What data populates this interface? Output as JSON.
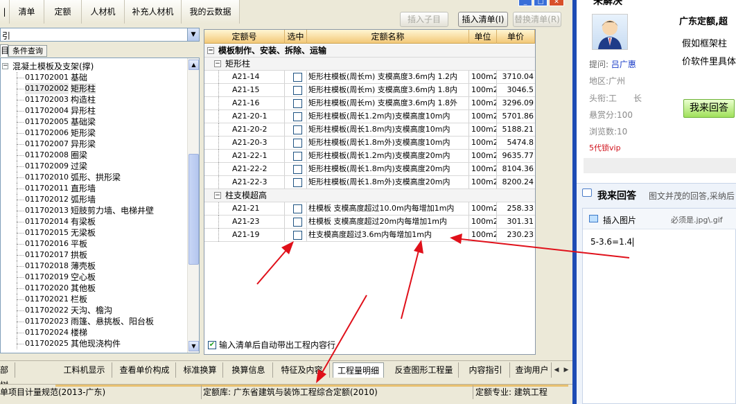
{
  "top_tabs": [
    "清单",
    "定额",
    "人材机",
    "补充人材机",
    "我的云数据"
  ],
  "top_tab_left": "|",
  "window_buttons": [
    "_",
    "□",
    "✕"
  ],
  "actions": {
    "insert_child": "插入子目",
    "insert_list": "插入清单(I)",
    "replace_list": "替换清单(R)"
  },
  "search": {
    "left_value": "引"
  },
  "left_tabs": {
    "tab1": "目",
    "tab2": "条件查询"
  },
  "tree": {
    "root": "混凝土模板及支架(撑)",
    "items": [
      {
        "code": "011702001",
        "name": "基础"
      },
      {
        "code": "011702002",
        "name": "矩形柱"
      },
      {
        "code": "011702003",
        "name": "构造柱"
      },
      {
        "code": "011702004",
        "name": "异形柱"
      },
      {
        "code": "011702005",
        "name": "基础梁"
      },
      {
        "code": "011702006",
        "name": "矩形梁"
      },
      {
        "code": "011702007",
        "name": "异形梁"
      },
      {
        "code": "011702008",
        "name": "圈梁"
      },
      {
        "code": "011702009",
        "name": "过梁"
      },
      {
        "code": "011702010",
        "name": "弧形、拱形梁"
      },
      {
        "code": "011702011",
        "name": "直形墙"
      },
      {
        "code": "011702012",
        "name": "弧形墙"
      },
      {
        "code": "011702013",
        "name": "短肢剪力墙、电梯井壁"
      },
      {
        "code": "011702014",
        "name": "有梁板"
      },
      {
        "code": "011702015",
        "name": "无梁板"
      },
      {
        "code": "011702016",
        "name": "平板"
      },
      {
        "code": "011702017",
        "name": "拱板"
      },
      {
        "code": "011702018",
        "name": "薄壳板"
      },
      {
        "code": "011702019",
        "name": "空心板"
      },
      {
        "code": "011702020",
        "name": "其他板"
      },
      {
        "code": "011702021",
        "name": "栏板"
      },
      {
        "code": "011702022",
        "name": "天沟、檐沟"
      },
      {
        "code": "011702023",
        "name": "雨篷、悬挑板、阳台板"
      },
      {
        "code": "011702024",
        "name": "楼梯"
      },
      {
        "code": "011702025",
        "name": "其他现浇构件"
      }
    ]
  },
  "grid": {
    "headers": [
      "定额号",
      "选中",
      "定额名称",
      "单位",
      "单价"
    ],
    "group": "模板制作、安装、拆除、运输",
    "sub1": "矩形柱",
    "rows1": [
      {
        "code": "A21-14",
        "name": "矩形柱模板(周长m) 支模高度3.6m内 1.2内",
        "unit": "100m2",
        "price": "3710.04"
      },
      {
        "code": "A21-15",
        "name": "矩形柱模板(周长m) 支模高度3.6m内 1.8内",
        "unit": "100m2",
        "price": "3046.5"
      },
      {
        "code": "A21-16",
        "name": "矩形柱模板(周长m) 支模高度3.6m内 1.8外",
        "unit": "100m2",
        "price": "3296.09"
      },
      {
        "code": "A21-20-1",
        "name": "矩形柱模板(周长1.2m内)支模高度10m内",
        "unit": "100m2",
        "price": "5701.86"
      },
      {
        "code": "A21-20-2",
        "name": "矩形柱模板(周长1.8m内)支模高度10m内",
        "unit": "100m2",
        "price": "5188.21"
      },
      {
        "code": "A21-20-3",
        "name": "矩形柱模板(周长1.8m外)支模高度10m内",
        "unit": "100m2",
        "price": "5474.8"
      },
      {
        "code": "A21-22-1",
        "name": "矩形柱模板(周长1.2m内)支模高度20m内",
        "unit": "100m2",
        "price": "9635.77"
      },
      {
        "code": "A21-22-2",
        "name": "矩形柱模板(周长1.8m内)支模高度20m内",
        "unit": "100m2",
        "price": "8104.36"
      },
      {
        "code": "A21-22-3",
        "name": "矩形柱模板(周长1.8m外)支模高度20m内",
        "unit": "100m2",
        "price": "8200.24"
      }
    ],
    "sub2": "柱支模超高",
    "rows2": [
      {
        "code": "A21-21",
        "name": "柱模板 支模高度超过10.0m内每增加1m内",
        "unit": "100m2",
        "price": "258.33"
      },
      {
        "code": "A21-23",
        "name": "柱模板 支模高度超过20m内每增加1m内",
        "unit": "100m2",
        "price": "301.31"
      },
      {
        "code": "A21-19",
        "name": "柱支模高度超过3.6m内每增加1m内",
        "unit": "100m2",
        "price": "230.23"
      }
    ],
    "auto_label": "输入清单后自动带出工程内容行"
  },
  "bottom_tabs": [
    "部树",
    "工料机显示",
    "查看单价构成",
    "标准换算",
    "换算信息",
    "特征及内容",
    "工程量明细",
    "反查图形工程量",
    "内容指引",
    "查询用户"
  ],
  "status": {
    "left": "单项目计量规范(2013-广东)",
    "middle": "定额库: 广东省建筑与装饰工程综合定额(2010)",
    "right": "定额专业: 建筑工程"
  },
  "right_panel": {
    "top_cut": "未解决",
    "question_title": "广东定额,超",
    "question_line1": "假如框架柱",
    "question_line2": "价软件里具体",
    "asker_label": "提问:",
    "asker_name": "吕广惠",
    "region": "地区:广州",
    "rank": "头衔:工　　长",
    "reward": "悬赏分:100",
    "views": "浏览数:10",
    "vip": "5代锁vip",
    "answer_button": "我来回答",
    "answer_title": "我来回答",
    "answer_hint": "图文并茂的回答,采纳后",
    "insert_image": "插入图片",
    "image_hint": "必须是.jpg\\.gif",
    "editor_text": "5-3.6=1.4"
  }
}
